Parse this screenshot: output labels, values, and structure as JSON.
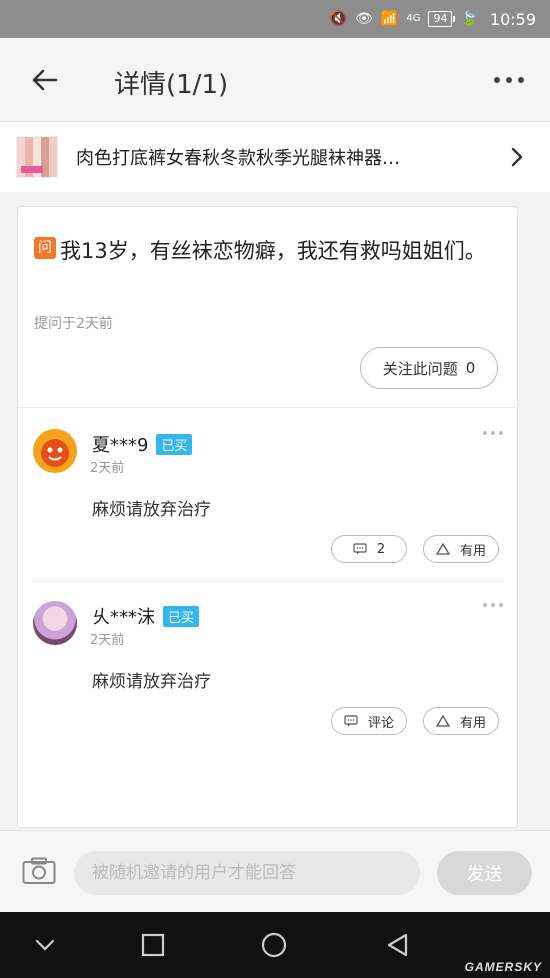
{
  "status_bar": {
    "network": "4G",
    "battery": "94",
    "time": "10:59"
  },
  "header": {
    "title": "详情(1/1)"
  },
  "product": {
    "name": "肉色打底裤女春秋冬款秋季光腿袜神器…"
  },
  "question": {
    "badge": "问",
    "text": "我13岁，有丝袜恋物癖，我还有救吗姐姐们。",
    "time": "提问于2天前",
    "follow_label": "关注此问题",
    "follow_count": "0"
  },
  "answers": [
    {
      "user": "夏***9",
      "badge": "已买",
      "time": "2天前",
      "text": "麻烦请放弃治疗",
      "comment_label": "2",
      "useful_label": "有用"
    },
    {
      "user": "乆***沫",
      "badge": "已买",
      "time": "2天前",
      "text": "麻烦请放弃治疗",
      "comment_label": "评论",
      "useful_label": "有用"
    }
  ],
  "reply": {
    "placeholder": "被随机邀请的用户才能回答",
    "send_label": "发送"
  },
  "watermark": "GAMERSKY"
}
